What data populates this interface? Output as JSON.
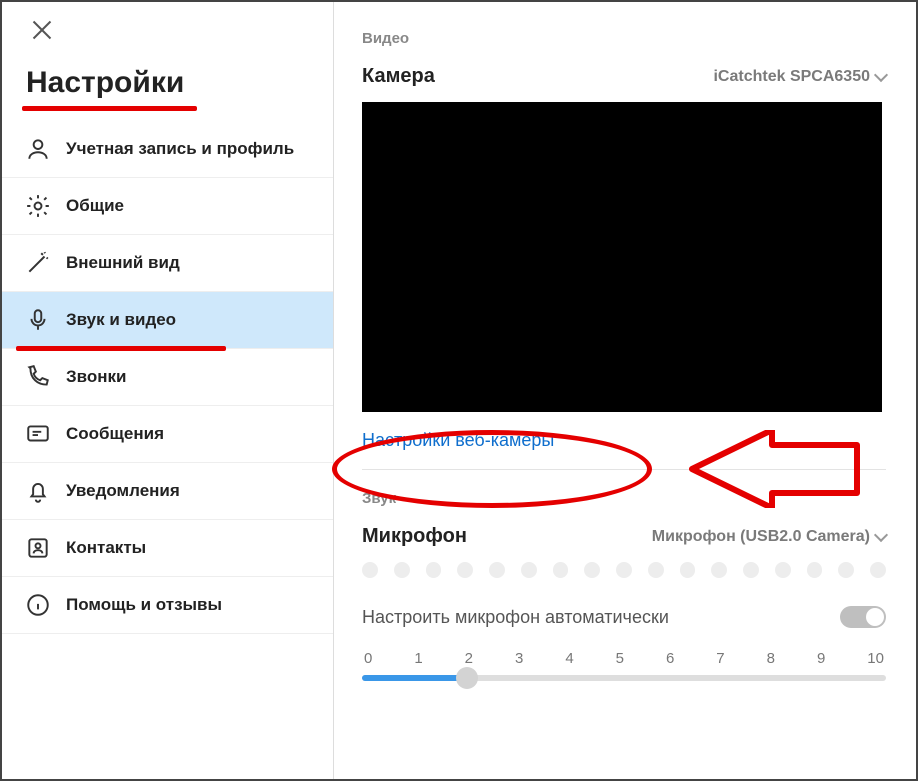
{
  "title": "Настройки",
  "sidebar": {
    "items": [
      {
        "label": "Учетная запись и профиль"
      },
      {
        "label": "Общие"
      },
      {
        "label": "Внешний вид"
      },
      {
        "label": "Звук и видео"
      },
      {
        "label": "Звонки"
      },
      {
        "label": "Сообщения"
      },
      {
        "label": "Уведомления"
      },
      {
        "label": "Контакты"
      },
      {
        "label": "Помощь и отзывы"
      }
    ]
  },
  "video": {
    "section": "Видео",
    "camera_label": "Камера",
    "camera_device": "iCatchtek SPCA6350",
    "webcam_settings": "Настройки веб-камеры"
  },
  "audio": {
    "section": "Звук",
    "mic_label": "Микрофон",
    "mic_device": "Микрофон (USB2.0 Camera)",
    "auto_label": "Настроить микрофон автоматически",
    "ticks": [
      "0",
      "1",
      "2",
      "3",
      "4",
      "5",
      "6",
      "7",
      "8",
      "9",
      "10"
    ],
    "slider_value": 2
  }
}
